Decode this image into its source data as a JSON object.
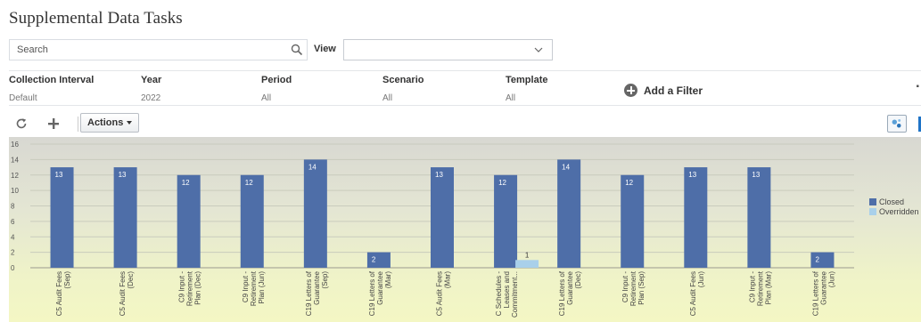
{
  "page": {
    "title": "Supplemental Data Tasks"
  },
  "search": {
    "placeholder": "Search",
    "value": ""
  },
  "view": {
    "label": "View",
    "selected": ""
  },
  "filters": [
    {
      "label": "Collection Interval",
      "value": "Default"
    },
    {
      "label": "Year",
      "value": "2022"
    },
    {
      "label": "Period",
      "value": "All"
    },
    {
      "label": "Scenario",
      "value": "All"
    },
    {
      "label": "Template",
      "value": "All"
    }
  ],
  "add_filter": {
    "label": "Add a Filter"
  },
  "toolbar": {
    "actions_label": "Actions"
  },
  "colors": {
    "closed": "#4e6ea8",
    "overridden": "#a9d0ea",
    "accent": "#1f74c7"
  },
  "chart_data": {
    "type": "bar",
    "categories": [
      "C5 Audit Fees (Sep)",
      "C5 Audit Fees (Dec)",
      "C9 Input - Retirement Plan (Dec)",
      "C9 Input - Retirement Plan (Jun)",
      "C19 Letters of Guarantee (Sep)",
      "C19 Letters of Guarantee (Mar)",
      "C5 Audit Fees (Mar)",
      "C Schedules - Leases and Commitment...",
      "C19 Letters of Guarantee (Dec)",
      "C9 Input - Retirement Plan (Sep)",
      "C5 Audit Fees (Jun)",
      "C9 Input - Retirement Plan (Mar)",
      "C19 Letters of Guarantee (Jun)"
    ],
    "series": [
      {
        "name": "Closed",
        "values": [
          13,
          13,
          12,
          12,
          14,
          2,
          13,
          12,
          14,
          12,
          13,
          13,
          2
        ]
      },
      {
        "name": "Overridden",
        "values": [
          null,
          null,
          null,
          null,
          null,
          null,
          null,
          1,
          null,
          null,
          null,
          null,
          null
        ]
      }
    ],
    "ylim": [
      0,
      16
    ],
    "yticks": [
      0,
      2,
      4,
      6,
      8,
      10,
      12,
      14,
      16
    ],
    "grid": true,
    "legend": "right"
  }
}
